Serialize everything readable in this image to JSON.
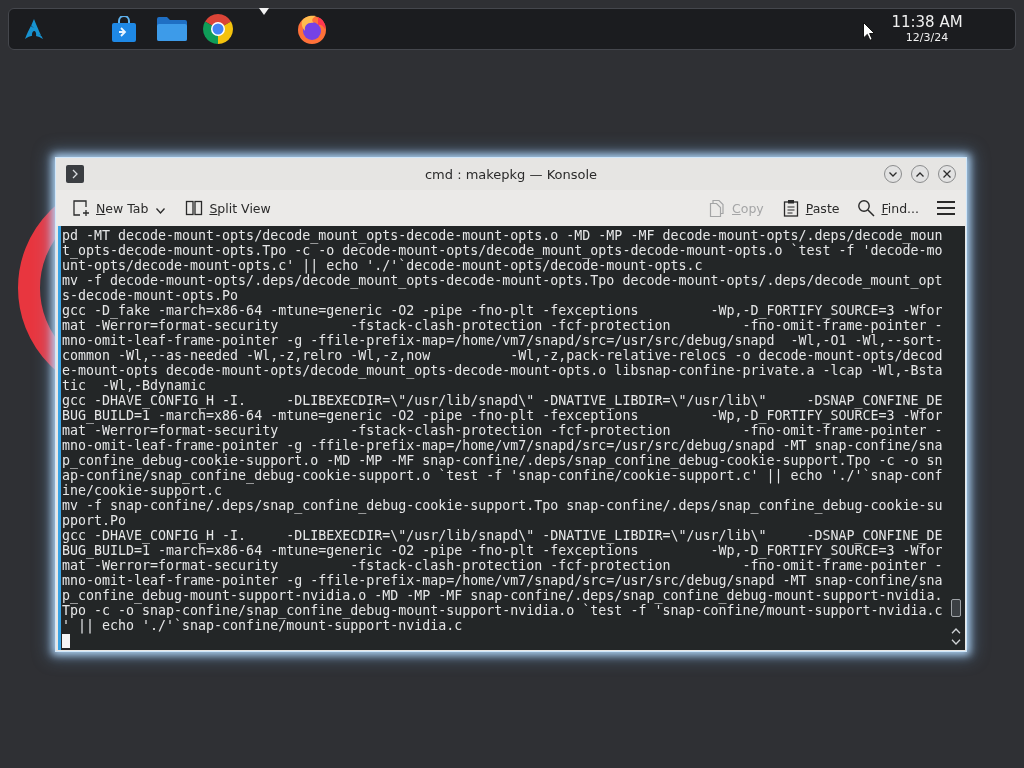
{
  "taskbar": {
    "clock": {
      "time": "11:38 AM",
      "date": "12/3/24"
    }
  },
  "window": {
    "title": "cmd : makepkg — Konsole",
    "left_actions": [
      {
        "kind": "new-tab",
        "label": "New Tab",
        "disabled": false
      },
      {
        "kind": "split-view",
        "label": "Split View",
        "disabled": false
      }
    ],
    "right_actions": [
      {
        "kind": "copy",
        "label": "Copy",
        "disabled": true
      },
      {
        "kind": "paste",
        "label": "Paste",
        "disabled": false
      },
      {
        "kind": "find",
        "label": "Find...",
        "disabled": false
      },
      {
        "kind": "menu",
        "disabled": false
      }
    ]
  },
  "terminal": {
    "lines": [
      "pd -MT decode-mount-opts/decode_mount_opts-decode-mount-opts.o -MD -MP -MF decode-mount-opts/.deps/decode_moun",
      "t_opts-decode-mount-opts.Tpo -c -o decode-mount-opts/decode_mount_opts-decode-mount-opts.o `test -f 'decode-mo",
      "unt-opts/decode-mount-opts.c' || echo './'`decode-mount-opts/decode-mount-opts.c",
      "mv -f decode-mount-opts/.deps/decode_mount_opts-decode-mount-opts.Tpo decode-mount-opts/.deps/decode_mount_opt",
      "s-decode-mount-opts.Po",
      "gcc -D_fake -march=x86-64 -mtune=generic -O2 -pipe -fno-plt -fexceptions         -Wp,-D_FORTIFY_SOURCE=3 -Wfor",
      "mat -Werror=format-security         -fstack-clash-protection -fcf-protection         -fno-omit-frame-pointer -",
      "mno-omit-leaf-frame-pointer -g -ffile-prefix-map=/home/vm7/snapd/src=/usr/src/debug/snapd  -Wl,-O1 -Wl,--sort-",
      "common -Wl,--as-needed -Wl,-z,relro -Wl,-z,now          -Wl,-z,pack-relative-relocs -o decode-mount-opts/decod",
      "e-mount-opts decode-mount-opts/decode_mount_opts-decode-mount-opts.o libsnap-confine-private.a -lcap -Wl,-Bsta",
      "tic  -Wl,-Bdynamic",
      "gcc -DHAVE_CONFIG_H -I.     -DLIBEXECDIR=\\\"/usr/lib/snapd\\\" -DNATIVE_LIBDIR=\\\"/usr/lib\\\"     -DSNAP_CONFINE_DE",
      "BUG_BUILD=1 -march=x86-64 -mtune=generic -O2 -pipe -fno-plt -fexceptions         -Wp,-D_FORTIFY_SOURCE=3 -Wfor",
      "mat -Werror=format-security         -fstack-clash-protection -fcf-protection         -fno-omit-frame-pointer -",
      "mno-omit-leaf-frame-pointer -g -ffile-prefix-map=/home/vm7/snapd/src=/usr/src/debug/snapd -MT snap-confine/sna",
      "p_confine_debug-cookie-support.o -MD -MP -MF snap-confine/.deps/snap_confine_debug-cookie-support.Tpo -c -o sn",
      "ap-confine/snap_confine_debug-cookie-support.o `test -f 'snap-confine/cookie-support.c' || echo './'`snap-conf",
      "ine/cookie-support.c",
      "mv -f snap-confine/.deps/snap_confine_debug-cookie-support.Tpo snap-confine/.deps/snap_confine_debug-cookie-su",
      "pport.Po",
      "gcc -DHAVE_CONFIG_H -I.     -DLIBEXECDIR=\\\"/usr/lib/snapd\\\" -DNATIVE_LIBDIR=\\\"/usr/lib\\\"     -DSNAP_CONFINE_DE",
      "BUG_BUILD=1 -march=x86-64 -mtune=generic -O2 -pipe -fno-plt -fexceptions         -Wp,-D_FORTIFY_SOURCE=3 -Wfor",
      "mat -Werror=format-security         -fstack-clash-protection -fcf-protection         -fno-omit-frame-pointer -",
      "mno-omit-leaf-frame-pointer -g -ffile-prefix-map=/home/vm7/snapd/src=/usr/src/debug/snapd -MT snap-confine/sna",
      "p_confine_debug-mount-support-nvidia.o -MD -MP -MF snap-confine/.deps/snap_confine_debug-mount-support-nvidia.",
      "Tpo -c -o snap-confine/snap_confine_debug-mount-support-nvidia.o `test -f 'snap-confine/mount-support-nvidia.c",
      "' || echo './'`snap-confine/mount-support-nvidia.c"
    ],
    "cursor": true
  }
}
